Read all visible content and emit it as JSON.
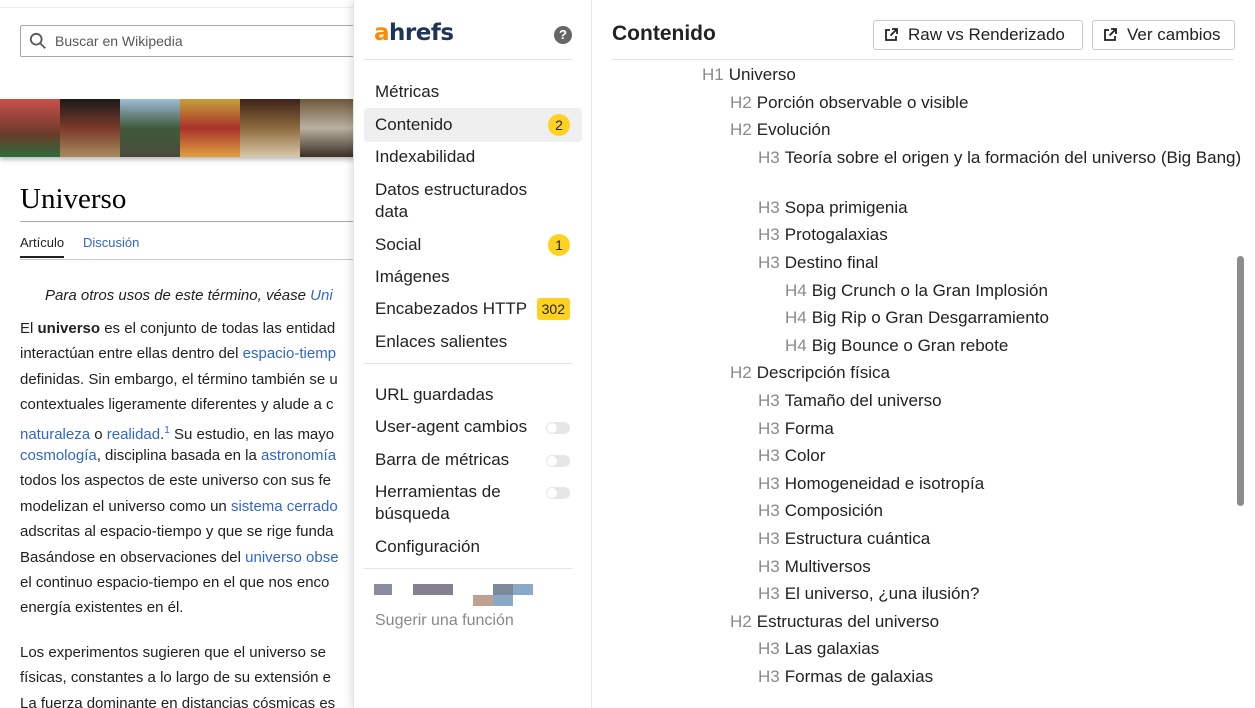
{
  "wiki": {
    "search_placeholder": "Buscar en Wikipedia",
    "title": "Universo",
    "tab_article": "Artículo",
    "tab_talk": "Discusión",
    "hatnote": {
      "prefix": "Para otros usos de este término, véase ",
      "link": "Uni"
    },
    "para1": [
      [
        {
          "t": "El "
        },
        {
          "t": "universo",
          "b": true
        },
        {
          "t": " es el conjunto de todas las entidad"
        }
      ],
      [
        {
          "t": "interactúan entre ellas dentro del "
        },
        {
          "t": "espacio-tiemp",
          "l": true
        }
      ],
      [
        {
          "t": "definidas. Sin embargo, el término también se u"
        }
      ],
      [
        {
          "t": "contextuales ligeramente diferentes y alude a c"
        }
      ],
      [
        {
          "t": "naturaleza",
          "l": true
        },
        {
          "t": " o "
        },
        {
          "t": "realidad",
          "l": true
        },
        {
          "t": "."
        },
        {
          "t": "1",
          "s": true
        },
        {
          "t": "  Su estudio, en las mayo"
        }
      ],
      [
        {
          "t": "cosmología",
          "l": true
        },
        {
          "t": ", disciplina basada en la "
        },
        {
          "t": "astronomía",
          "l": true
        }
      ],
      [
        {
          "t": "todos los aspectos de este universo con sus fe"
        }
      ],
      [
        {
          "t": "modelizan el universo como un "
        },
        {
          "t": "sistema cerrado",
          "l": true
        }
      ],
      [
        {
          "t": "adscritas al espacio-tiempo y que se rige funda"
        }
      ],
      [
        {
          "t": "Basándose en observaciones del "
        },
        {
          "t": "universo obse",
          "l": true
        }
      ],
      [
        {
          "t": "el continuo espacio-tiempo en el que nos enco"
        }
      ],
      [
        {
          "t": "energía existentes en él."
        }
      ]
    ],
    "para2": [
      [
        {
          "t": "Los experimentos sugieren que el universo se "
        }
      ],
      [
        {
          "t": "físicas, constantes a lo largo de su extensión e"
        }
      ],
      [
        {
          "t": "La fuerza dominante en distancias cósmicas es "
        }
      ]
    ]
  },
  "ahrefs": {
    "logo_a": "a",
    "logo_rest": "hrefs",
    "help": "?",
    "nav": [
      {
        "label": "Métricas"
      },
      {
        "label": "Contenido",
        "badge": "2",
        "active": true
      },
      {
        "label": "Indexabilidad"
      },
      {
        "label": "Datos estructurados data"
      },
      {
        "label": "Social",
        "badge": "1"
      },
      {
        "label": "Imágenes"
      },
      {
        "label": "Encabezados HTTP",
        "badge": "302"
      },
      {
        "label": "Enlaces salientes"
      }
    ],
    "settings": [
      {
        "label": "URL guardadas"
      },
      {
        "label": "User-agent cambios",
        "toggle": false
      },
      {
        "label": "Barra de métricas",
        "toggle": false
      },
      {
        "label": "Herramientas de búsqueda",
        "toggle": false
      },
      {
        "label": "Configuración"
      }
    ],
    "suggest": "Sugerir una función",
    "content_title": "Contenido",
    "btn_raw": "Raw vs Renderizado",
    "btn_changes": "Ver cambios",
    "headings": [
      {
        "level": "H1",
        "text": "Universo"
      },
      {
        "level": "H2",
        "text": "Porción observable o visible"
      },
      {
        "level": "H2",
        "text": "Evolución"
      },
      {
        "level": "H3",
        "text": "Teoría sobre el origen y la formación del universo (Big Bang)"
      },
      {
        "level": "H3",
        "text": "Sopa primigenia"
      },
      {
        "level": "H3",
        "text": "Protogalaxias"
      },
      {
        "level": "H3",
        "text": "Destino final"
      },
      {
        "level": "H4",
        "text": "Big Crunch o la Gran Implosión"
      },
      {
        "level": "H4",
        "text": "Big Rip o Gran Desgarramiento"
      },
      {
        "level": "H4",
        "text": "Big Bounce o Gran rebote"
      },
      {
        "level": "H2",
        "text": "Descripción física"
      },
      {
        "level": "H3",
        "text": "Tamaño del universo"
      },
      {
        "level": "H3",
        "text": "Forma"
      },
      {
        "level": "H3",
        "text": "Color"
      },
      {
        "level": "H3",
        "text": "Homogeneidad e isotropía"
      },
      {
        "level": "H3",
        "text": "Composición"
      },
      {
        "level": "H3",
        "text": "Estructura cuántica"
      },
      {
        "level": "H3",
        "text": "Multiversos"
      },
      {
        "level": "H3",
        "text": "El universo, ¿una ilusión?"
      },
      {
        "level": "H2",
        "text": "Estructuras del universo"
      },
      {
        "level": "H3",
        "text": "Las galaxias"
      },
      {
        "level": "H3",
        "text": "Formas de galaxias"
      }
    ]
  },
  "colors": {
    "accent": "#ff8a00",
    "badge": "#ffd21f",
    "link": "#3366cc"
  }
}
